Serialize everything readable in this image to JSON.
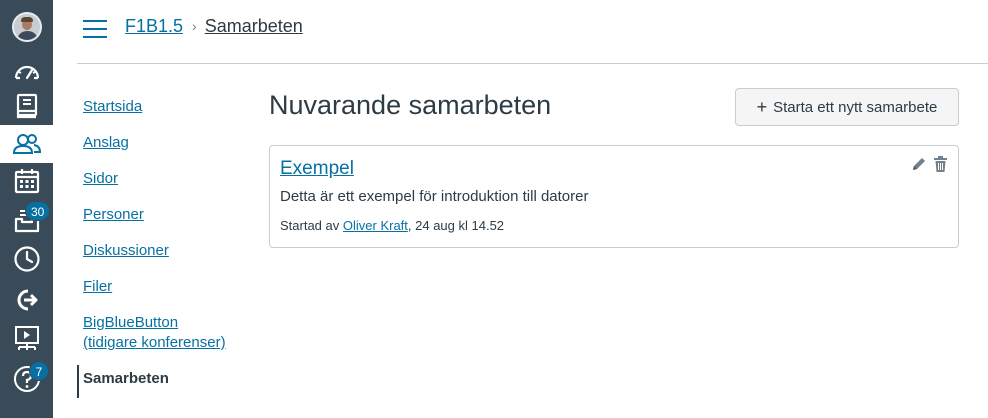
{
  "global_nav": {
    "items": [
      {
        "icon": "account-avatar"
      },
      {
        "icon": "dashboard-icon"
      },
      {
        "icon": "courses-icon"
      },
      {
        "icon": "groups-icon",
        "active": true
      },
      {
        "icon": "calendar-icon"
      },
      {
        "icon": "inbox-icon",
        "badge": "30"
      },
      {
        "icon": "history-icon"
      },
      {
        "icon": "logout-icon"
      },
      {
        "icon": "studio-icon"
      },
      {
        "icon": "help-icon",
        "badge": "7"
      }
    ]
  },
  "breadcrumb": {
    "course": "F1B1.5",
    "separator": "›",
    "current": "Samarbeten"
  },
  "course_nav": {
    "items": [
      {
        "label": "Startsida"
      },
      {
        "label": "Anslag"
      },
      {
        "label": "Sidor"
      },
      {
        "label": "Personer"
      },
      {
        "label": "Diskussioner"
      },
      {
        "label": "Filer"
      },
      {
        "label_line1": "BigBlueButton",
        "label_line2": "(tidigare konferenser)"
      },
      {
        "label": "Samarbeten",
        "active": true
      }
    ]
  },
  "main": {
    "title": "Nuvarande samarbeten",
    "new_button": {
      "plus": "+",
      "label": "Starta ett nytt samarbete"
    },
    "collaborations": [
      {
        "title": "Exempel",
        "description": "Detta är ett exempel för introduktion till datorer",
        "meta_prefix": "Startad av",
        "author": "Oliver Kraft",
        "meta_suffix": ", 24 aug kl 14.52"
      }
    ]
  },
  "colors": {
    "nav_bg": "#394b58",
    "link": "#0770a3",
    "text": "#2d3b45",
    "border": "#c7cdd1",
    "badge": "#0770a3"
  }
}
